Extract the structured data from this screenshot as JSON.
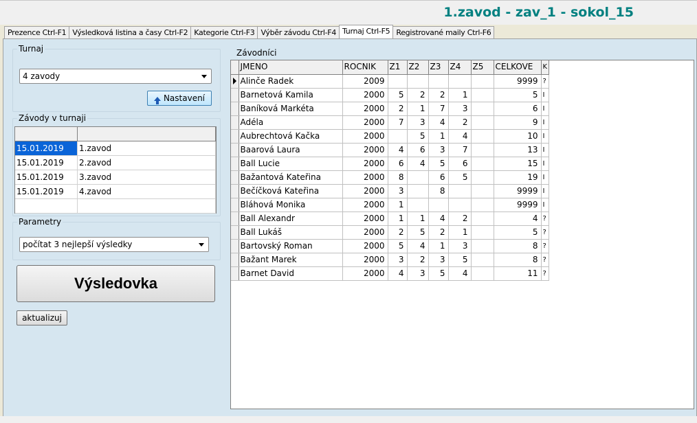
{
  "header": {
    "title": "1.zavod - zav_1 - sokol_15"
  },
  "tabs": [
    {
      "label": "Prezence Ctrl-F1",
      "active": false
    },
    {
      "label": "Výsledková listina a časy Ctrl-F2",
      "active": false
    },
    {
      "label": "Kategorie Ctrl-F3",
      "active": false
    },
    {
      "label": "Výběr závodu Ctrl-F4",
      "active": false
    },
    {
      "label": "Turnaj Ctrl-F5",
      "active": true
    },
    {
      "label": "Registrované maily Ctrl-F6",
      "active": false
    }
  ],
  "turnaj": {
    "legend": "Turnaj",
    "selected": "4 zavody",
    "nastaveni_label": "Nastavení"
  },
  "zavody_v_turnaji": {
    "legend": "Závody v turnaji",
    "rows": [
      {
        "date": "15.01.2019",
        "name": "1.zavod"
      },
      {
        "date": "15.01.2019",
        "name": "2.zavod"
      },
      {
        "date": "15.01.2019",
        "name": "3.zavod"
      },
      {
        "date": "15.01.2019",
        "name": "4.zavod"
      }
    ]
  },
  "parametry": {
    "legend": "Parametry",
    "selected": "počítat 3 nejlepší výsledky"
  },
  "actions": {
    "vysledovka_label": "Výsledovka",
    "aktualizuj_label": "aktualizuj"
  },
  "zavodnici": {
    "legend": "Závodníci",
    "columns": [
      "JMENO",
      "ROCNIK",
      "Z1",
      "Z2",
      "Z3",
      "Z4",
      "Z5",
      "CELKOVE",
      "K"
    ],
    "rows": [
      {
        "jmeno": "Alinče Radek",
        "rocnik": "2009",
        "z1": "",
        "z2": "",
        "z3": "",
        "z4": "",
        "z5": "",
        "celkove": "9999",
        "k": "?"
      },
      {
        "jmeno": "Barnetová Kamila",
        "rocnik": "2000",
        "z1": "5",
        "z2": "2",
        "z3": "2",
        "z4": "1",
        "z5": "",
        "celkove": "5",
        "k": "I"
      },
      {
        "jmeno": "Baníková Markéta",
        "rocnik": "2000",
        "z1": "2",
        "z2": "1",
        "z3": "7",
        "z4": "3",
        "z5": "",
        "celkove": "6",
        "k": "I"
      },
      {
        "jmeno": "Adéla",
        "rocnik": "2000",
        "z1": "7",
        "z2": "3",
        "z3": "4",
        "z4": "2",
        "z5": "",
        "celkove": "9",
        "k": "I"
      },
      {
        "jmeno": "Aubrechtová Kačka",
        "rocnik": "2000",
        "z1": "",
        "z2": "5",
        "z3": "1",
        "z4": "4",
        "z5": "",
        "celkove": "10",
        "k": "I"
      },
      {
        "jmeno": "Baarová Laura",
        "rocnik": "2000",
        "z1": "4",
        "z2": "6",
        "z3": "3",
        "z4": "7",
        "z5": "",
        "celkove": "13",
        "k": "I"
      },
      {
        "jmeno": "Ball Lucie",
        "rocnik": "2000",
        "z1": "6",
        "z2": "4",
        "z3": "5",
        "z4": "6",
        "z5": "",
        "celkove": "15",
        "k": "I"
      },
      {
        "jmeno": "Bažantová Kateřina",
        "rocnik": "2000",
        "z1": "8",
        "z2": "",
        "z3": "6",
        "z4": "5",
        "z5": "",
        "celkove": "19",
        "k": "I"
      },
      {
        "jmeno": "Bečíčková Kateřina",
        "rocnik": "2000",
        "z1": "3",
        "z2": "",
        "z3": "8",
        "z4": "",
        "z5": "",
        "celkove": "9999",
        "k": "I"
      },
      {
        "jmeno": "Bláhová Monika",
        "rocnik": "2000",
        "z1": "1",
        "z2": "",
        "z3": "",
        "z4": "",
        "z5": "",
        "celkove": "9999",
        "k": "I"
      },
      {
        "jmeno": "Ball Alexandr",
        "rocnik": "2000",
        "z1": "1",
        "z2": "1",
        "z3": "4",
        "z4": "2",
        "z5": "",
        "celkove": "4",
        "k": "?"
      },
      {
        "jmeno": "Ball Lukáš",
        "rocnik": "2000",
        "z1": "2",
        "z2": "5",
        "z3": "2",
        "z4": "1",
        "z5": "",
        "celkove": "5",
        "k": "?"
      },
      {
        "jmeno": "Bartovský Roman",
        "rocnik": "2000",
        "z1": "5",
        "z2": "4",
        "z3": "1",
        "z4": "3",
        "z5": "",
        "celkove": "8",
        "k": "?"
      },
      {
        "jmeno": "Bažant Marek",
        "rocnik": "2000",
        "z1": "3",
        "z2": "2",
        "z3": "3",
        "z4": "5",
        "z5": "",
        "celkove": "8",
        "k": "?"
      },
      {
        "jmeno": "Barnet David",
        "rocnik": "2000",
        "z1": "4",
        "z2": "3",
        "z3": "5",
        "z4": "4",
        "z5": "",
        "celkove": "11",
        "k": "?"
      }
    ]
  }
}
